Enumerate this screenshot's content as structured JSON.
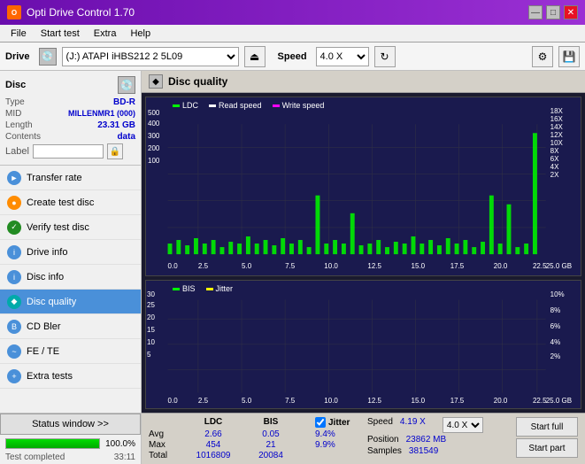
{
  "app": {
    "title": "Opti Drive Control 1.70",
    "icon": "ODC"
  },
  "title_buttons": [
    "—",
    "□",
    "✕"
  ],
  "menu": {
    "items": [
      "File",
      "Start test",
      "Extra",
      "Help"
    ]
  },
  "drive_toolbar": {
    "drive_label": "Drive",
    "drive_value": "(J:)  ATAPI iHBS212  2 5L09",
    "speed_label": "Speed",
    "speed_value": "4.0 X"
  },
  "disc": {
    "header": "Disc",
    "type_label": "Type",
    "type_value": "BD-R",
    "mid_label": "MID",
    "mid_value": "MILLENMR1 (000)",
    "length_label": "Length",
    "length_value": "23.31 GB",
    "contents_label": "Contents",
    "contents_value": "data",
    "label_label": "Label",
    "label_placeholder": ""
  },
  "sidebar": {
    "items": [
      {
        "id": "transfer-rate",
        "label": "Transfer rate",
        "icon": "►",
        "color": "blue"
      },
      {
        "id": "create-test-disc",
        "label": "Create test disc",
        "icon": "●",
        "color": "orange"
      },
      {
        "id": "verify-test-disc",
        "label": "Verify test disc",
        "icon": "✓",
        "color": "green"
      },
      {
        "id": "drive-info",
        "label": "Drive info",
        "icon": "i",
        "color": "blue"
      },
      {
        "id": "disc-info",
        "label": "Disc info",
        "icon": "i",
        "color": "blue"
      },
      {
        "id": "disc-quality",
        "label": "Disc quality",
        "icon": "◆",
        "color": "cyan",
        "active": true
      },
      {
        "id": "cd-bler",
        "label": "CD Bler",
        "icon": "B",
        "color": "blue"
      },
      {
        "id": "fe-te",
        "label": "FE / TE",
        "icon": "~",
        "color": "blue"
      },
      {
        "id": "extra-tests",
        "label": "Extra tests",
        "icon": "+",
        "color": "blue"
      }
    ]
  },
  "disc_quality": {
    "title": "Disc quality",
    "legend": {
      "ldc": "LDC",
      "read_speed": "Read speed",
      "write_speed": "Write speed",
      "bis": "BIS",
      "jitter": "Jitter"
    }
  },
  "stats": {
    "headers": [
      "LDC",
      "BIS",
      "",
      "Jitter",
      "Speed",
      "4.19 X",
      "",
      "4.0 X"
    ],
    "rows": [
      {
        "label": "Avg",
        "ldc": "2.66",
        "bis": "0.05",
        "jitter": "9.4%"
      },
      {
        "label": "Max",
        "ldc": "454",
        "bis": "21",
        "jitter": "9.9%"
      },
      {
        "label": "Total",
        "ldc": "1016809",
        "bis": "20084",
        "jitter": ""
      }
    ],
    "position_label": "Position",
    "position_value": "23862 MB",
    "samples_label": "Samples",
    "samples_value": "381549",
    "speed_value": "4.0 X",
    "jitter_checked": true
  },
  "buttons": {
    "start_full": "Start full",
    "start_part": "Start part",
    "status_window": "Status window >>"
  },
  "status": {
    "text": "Test completed",
    "progress": 100,
    "progress_text": "100.0%",
    "time": "33:11"
  },
  "chart_top": {
    "x_labels": [
      "0.0",
      "2.5",
      "5.0",
      "7.5",
      "10.0",
      "12.5",
      "15.0",
      "17.5",
      "20.0",
      "22.5",
      "25.0"
    ],
    "y_labels_left": [
      "500",
      "400",
      "300",
      "200",
      "100"
    ],
    "y_labels_right": [
      "18X",
      "16X",
      "14X",
      "12X",
      "10X",
      "8X",
      "6X",
      "4X",
      "2X"
    ],
    "unit": "GB"
  },
  "chart_bottom": {
    "x_labels": [
      "0.0",
      "2.5",
      "5.0",
      "7.5",
      "10.0",
      "12.5",
      "15.0",
      "17.5",
      "20.0",
      "22.5",
      "25.0"
    ],
    "y_labels_left": [
      "30",
      "25",
      "20",
      "15",
      "10",
      "5"
    ],
    "y_labels_right": [
      "10%",
      "8%",
      "6%",
      "4%",
      "2%"
    ],
    "unit": "GB"
  }
}
